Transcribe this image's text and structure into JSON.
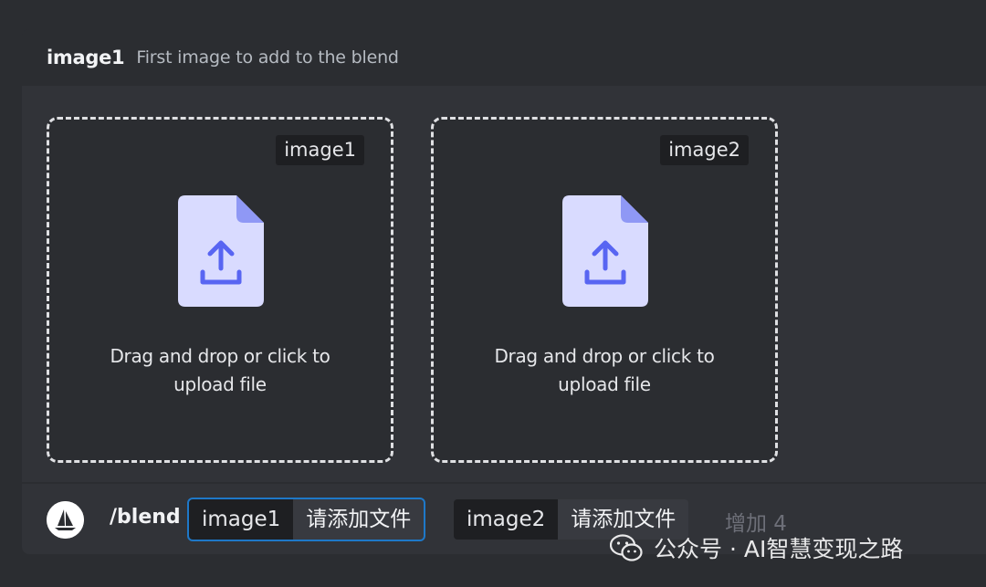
{
  "option": {
    "name": "image1",
    "description": "First image to add to the blend"
  },
  "upload_slots": [
    {
      "tag": "image1",
      "text_line1": "Drag and drop or click to",
      "text_line2": "upload file",
      "icon": "file-upload-icon"
    },
    {
      "tag": "image2",
      "text_line1": "Drag and drop or click to",
      "text_line2": "upload file",
      "icon": "file-upload-icon"
    }
  ],
  "command_bar": {
    "avatar_icon": "midjourney-sailboat-icon",
    "command": "/blend",
    "options": [
      {
        "name": "image1",
        "value": "请添加文件"
      },
      {
        "name": "image2",
        "value": "请添加文件"
      }
    ],
    "more_label": "增加 4"
  },
  "watermark": {
    "icon": "wechat-icon",
    "text": "公众号 · AI智慧变现之路"
  },
  "colors": {
    "background": "#2b2d31",
    "panel": "#313338",
    "file_icon": "#d9dbff",
    "file_icon_accent": "#5865f2",
    "focused_chip_border": "#1e78c8"
  }
}
